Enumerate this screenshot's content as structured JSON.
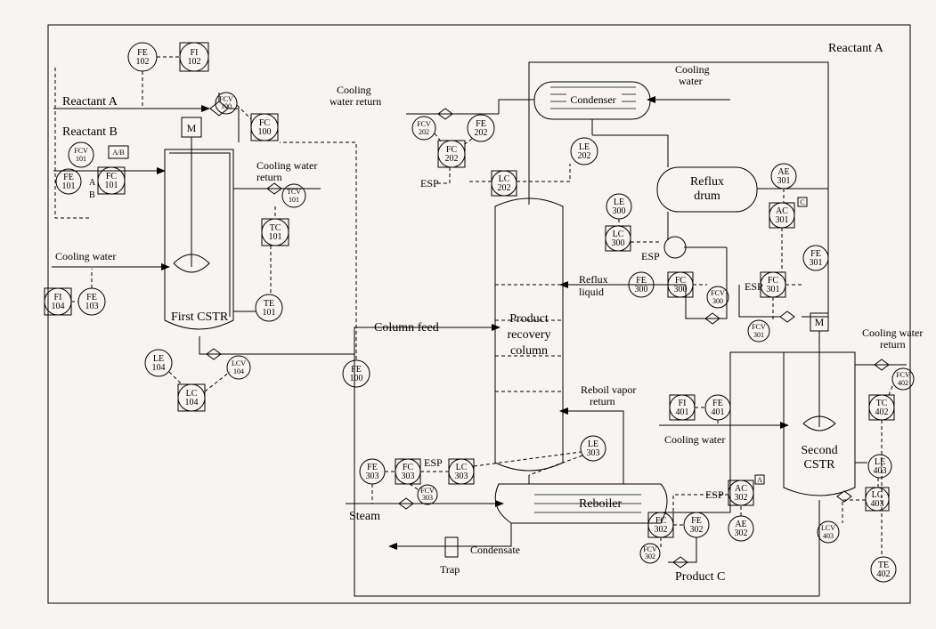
{
  "title_right": "Reactant A",
  "labels": {
    "reactant_a": "Reactant A",
    "reactant_b": "Reactant B",
    "cooling_water": "Cooling water",
    "cooling_water_return": "Cooling water\nreturn",
    "first_cstr": "First CSTR",
    "second_cstr": "Second\nCSTR",
    "column_feed": "Column feed",
    "product_recovery_column": "Product\nrecovery\ncolumn",
    "condenser": "Condenser",
    "reflux_drum": "Reflux\ndrum",
    "reflux_liquid": "Reflux\nliquid",
    "reboil_vapor_return": "Reboil vapor\nreturn",
    "reboiler": "Reboiler",
    "steam": "Steam",
    "condensate": "Condensate",
    "trap": "Trap",
    "product_c": "Product C",
    "esp": "ESP",
    "m": "M",
    "ab": "A/B",
    "a": "A",
    "b": "B",
    "c": "C"
  },
  "instruments": {
    "FE_100": {
      "tag": "FE",
      "num": "100"
    },
    "FE_101": {
      "tag": "FE",
      "num": "101"
    },
    "FE_102": {
      "tag": "FE",
      "num": "102"
    },
    "FE_103": {
      "tag": "FE",
      "num": "103"
    },
    "FE_202": {
      "tag": "FE",
      "num": "202"
    },
    "FE_300": {
      "tag": "FE",
      "num": "300"
    },
    "FE_301": {
      "tag": "FE",
      "num": "301"
    },
    "FE_302": {
      "tag": "FE",
      "num": "302"
    },
    "FE_303": {
      "tag": "FE",
      "num": "303"
    },
    "FE_401": {
      "tag": "FE",
      "num": "401"
    },
    "FI_102": {
      "tag": "FI",
      "num": "102"
    },
    "FI_104": {
      "tag": "FI",
      "num": "104"
    },
    "FI_401": {
      "tag": "FI",
      "num": "401"
    },
    "FC_100": {
      "tag": "FC",
      "num": "100"
    },
    "FC_101": {
      "tag": "FC",
      "num": "101"
    },
    "FC_202": {
      "tag": "FC",
      "num": "202"
    },
    "FC_300": {
      "tag": "FC",
      "num": "300"
    },
    "FC_301": {
      "tag": "FC",
      "num": "301"
    },
    "FC_302": {
      "tag": "FC",
      "num": "302"
    },
    "FC_303": {
      "tag": "FC",
      "num": "303"
    },
    "FCV_100": {
      "tag": "FCV",
      "num": "100"
    },
    "FCV_101": {
      "tag": "FCV",
      "num": "101"
    },
    "FCV_202": {
      "tag": "FCV",
      "num": "202"
    },
    "FCV_300": {
      "tag": "FCV",
      "num": "300"
    },
    "FCV_301": {
      "tag": "FCV",
      "num": "301"
    },
    "FCV_302": {
      "tag": "FCV",
      "num": "302"
    },
    "FCV_303": {
      "tag": "FCV",
      "num": "303"
    },
    "FCV_402": {
      "tag": "FCV",
      "num": "402"
    },
    "TC_101": {
      "tag": "TC",
      "num": "101"
    },
    "TC_402": {
      "tag": "TC",
      "num": "402"
    },
    "TCV_101": {
      "tag": "TCV",
      "num": "101"
    },
    "TE_101": {
      "tag": "TE",
      "num": "101"
    },
    "TE_402": {
      "tag": "TE",
      "num": "402"
    },
    "LE_104": {
      "tag": "LE",
      "num": "104"
    },
    "LE_202": {
      "tag": "LE",
      "num": "202"
    },
    "LE_300": {
      "tag": "LE",
      "num": "300"
    },
    "LE_303": {
      "tag": "LE",
      "num": "303"
    },
    "LE_403": {
      "tag": "LE",
      "num": "403"
    },
    "LC_104": {
      "tag": "LC",
      "num": "104"
    },
    "LC_202": {
      "tag": "LC",
      "num": "202"
    },
    "LC_300": {
      "tag": "LC",
      "num": "300"
    },
    "LC_303": {
      "tag": "LC",
      "num": "303"
    },
    "LC_403": {
      "tag": "LC",
      "num": "403"
    },
    "LCV_104": {
      "tag": "LCV",
      "num": "104"
    },
    "LCV_403": {
      "tag": "LCV",
      "num": "403"
    },
    "AE_301": {
      "tag": "AE",
      "num": "301"
    },
    "AE_302": {
      "tag": "AE",
      "num": "302"
    },
    "AC_301": {
      "tag": "AC",
      "num": "301"
    },
    "AC_302": {
      "tag": "AC",
      "num": "302"
    }
  }
}
